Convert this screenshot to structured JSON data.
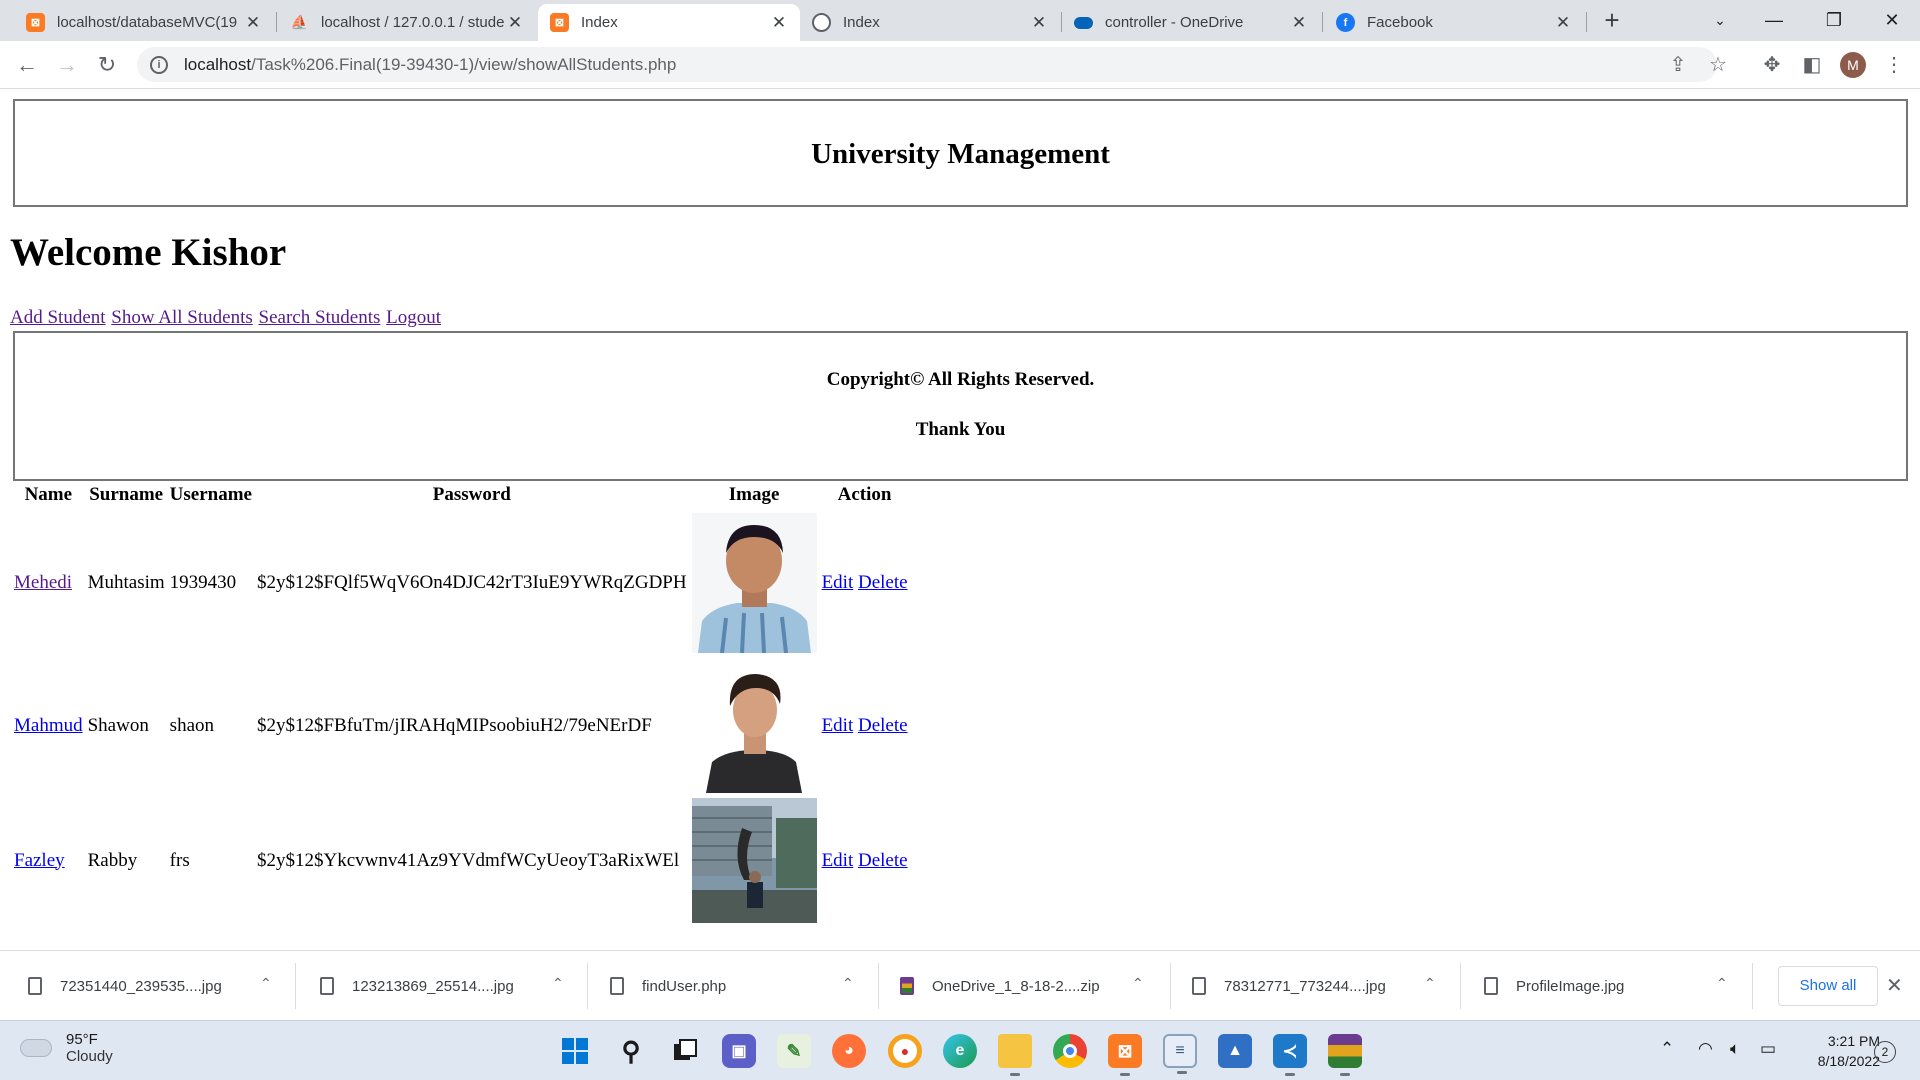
{
  "browser": {
    "tabs": [
      {
        "title": "localhost/databaseMVC(19",
        "icon": "xampp-icon",
        "active": false
      },
      {
        "title": "localhost / 127.0.0.1 / stude",
        "icon": "phpmyadmin-icon",
        "active": false
      },
      {
        "title": "Index",
        "icon": "xampp-icon",
        "active": true
      },
      {
        "title": "Index",
        "icon": "globe-icon",
        "active": false
      },
      {
        "title": "controller - OneDrive",
        "icon": "onedrive-icon",
        "active": false
      },
      {
        "title": "Facebook",
        "icon": "facebook-icon",
        "active": false
      }
    ],
    "url_host": "localhost",
    "url_path": "/Task%206.Final(19-39430-1)/view/showAllStudents.php",
    "profile_initial": "M"
  },
  "page": {
    "header_title": "University Management",
    "welcome": "Welcome Kishor",
    "nav_links": [
      "Add Student",
      "Show All Students",
      "Search Students",
      "Logout"
    ],
    "footer_line1": "Copyright© All Rights Reserved.",
    "footer_line2": "Thank You",
    "table": {
      "headers": [
        "Name",
        "Surname",
        "Username",
        "Password",
        "Image",
        "Action"
      ],
      "rows": [
        {
          "name": "Mehedi",
          "surname": "Muhtasim",
          "username": "1939430",
          "password": "$2y$12$FQlf5WqV6On4DJC42rT3IuE9YWRqZGDPH",
          "edit": "Edit",
          "delete": "Delete"
        },
        {
          "name": "Mahmud",
          "surname": "Shawon",
          "username": "shaon",
          "password": "$2y$12$FBfuTm/jIRAHqMIPsoobiuH2/79eNErDF",
          "edit": "Edit",
          "delete": "Delete"
        },
        {
          "name": "Fazley",
          "surname": "Rabby",
          "username": "frs",
          "password": "$2y$12$Ykcvwnv41Az9YVdmfWCyUeoyT3aRixWEl",
          "edit": "Edit",
          "delete": "Delete"
        }
      ]
    }
  },
  "downloads": {
    "items": [
      "72351440_239535....jpg",
      "123213869_25514....jpg",
      "findUser.php",
      "OneDrive_1_8-18-2....zip",
      "78312771_773244....jpg",
      "ProfileImage.jpg"
    ],
    "show_all": "Show all"
  },
  "taskbar": {
    "weather_temp": "95°F",
    "weather_desc": "Cloudy",
    "time": "3:21 PM",
    "date": "8/18/2022",
    "notification_count": "2"
  }
}
